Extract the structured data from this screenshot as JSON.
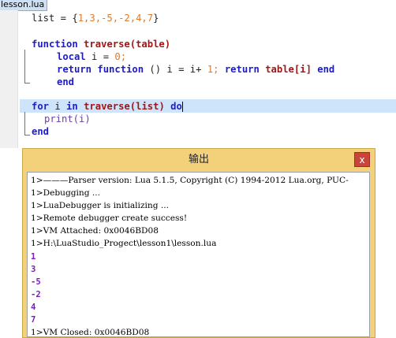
{
  "editor": {
    "tab_label": "lesson.lua",
    "lines": {
      "l1": {
        "a": "list = {",
        "b": "1,3,-5,-2,4,7",
        "c": "}"
      },
      "l3": {
        "kw": "function",
        "fn": "traverse",
        "rest": "(table)"
      },
      "l4": {
        "kw": "local",
        "rest": " i = ",
        "num": "0",
        "end": ";"
      },
      "l5": {
        "kw1": "return",
        "kw2": "function",
        "mid": " () i = i+ ",
        "num": "1",
        "semi": "; ",
        "kw3": "return",
        "fn": "table",
        "idx": "[i] ",
        "kw4": "end"
      },
      "l6": {
        "kw": "end"
      },
      "l8": {
        "kw1": "for",
        "mid": " i ",
        "kw2": "in",
        "fn": "traverse",
        "args": "(list) ",
        "kw3": "do"
      },
      "l9": {
        "text": "print(i)"
      },
      "l10": {
        "kw": "end"
      }
    }
  },
  "output": {
    "title": "输出",
    "close_label": "x",
    "lines": [
      "1>———Parser version: Lua 5.1.5, Copyright (C) 1994-2012 Lua.org, PUC-",
      "1>Debugging ...",
      "1>LuaDebugger is initializing ...",
      "1>Remote debugger create success!",
      "1>VM Attached: 0x0046BD08",
      "1>H:\\LuaStudio_Progect\\lesson1\\lesson.lua"
    ],
    "results": [
      "1",
      "3",
      "-5",
      "-2",
      "4",
      "7"
    ],
    "closing": "1>VM Closed: 0x0046BD08"
  }
}
